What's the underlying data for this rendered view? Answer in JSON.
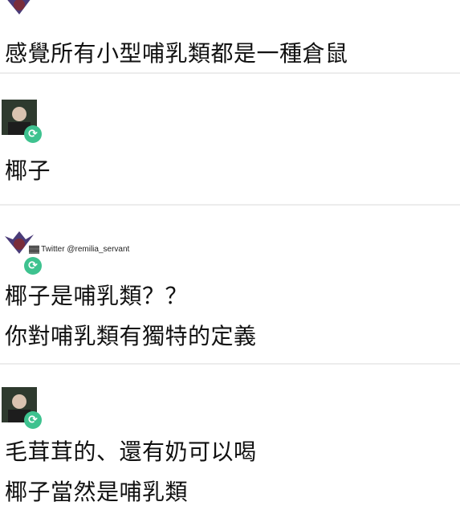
{
  "watermark": {
    "mark": "▓▓",
    "text": "Twitter @remilia_servant"
  },
  "posts": [
    {
      "lines": [
        "感覺所有小型哺乳類都是一種倉鼠"
      ]
    },
    {
      "lines": [
        "椰子"
      ]
    },
    {
      "lines": [
        "椰子是哺乳類？？",
        "你對哺乳類有獨特的定義"
      ]
    },
    {
      "lines": [
        "毛茸茸的、還有奶可以喝",
        "椰子當然是哺乳類"
      ]
    }
  ],
  "icons": {
    "retweet_badge": "retweet-icon",
    "retweet_glyph": "⟳"
  },
  "colors": {
    "badge": "#3ec28f",
    "divider": "#ececec",
    "text": "#111111"
  }
}
